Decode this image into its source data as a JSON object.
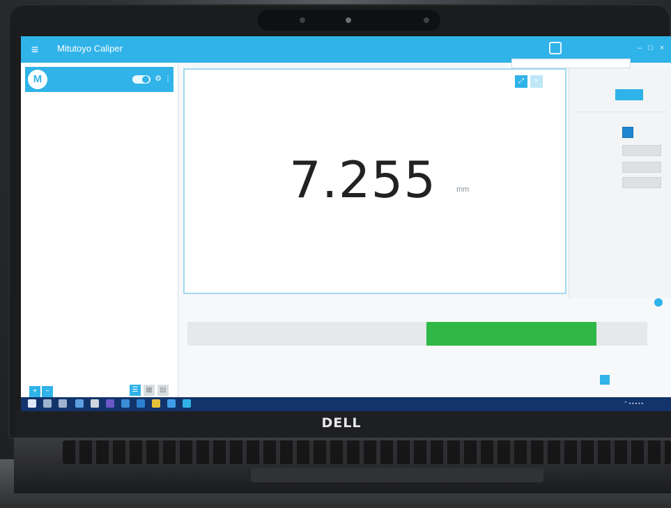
{
  "laptop": {
    "brand_logo": "DELL"
  },
  "app": {
    "title": "Mitutoyo Caliper",
    "menu_icon": "hamburger-icon",
    "tooltip": "",
    "colors": {
      "accent": "#30b3e8",
      "bar_fill": "#2fb845",
      "taskbar": "#12346a"
    }
  },
  "sidebar": {
    "device_name": "",
    "device_status": "",
    "device_initial": "M",
    "select_label": "",
    "select_value": ""
  },
  "reading": {
    "value": "7.255",
    "unit": "mm"
  },
  "right_panel": {
    "top_label": "",
    "top_button": "",
    "check_label": "",
    "field_label": "",
    "field_value": "",
    "bottom_label": ""
  },
  "bottom_panel": {
    "title": "",
    "bar_fill_start": 0.52,
    "bar_fill_end": 0.89,
    "labels": [
      "",
      "",
      "",
      ""
    ],
    "buttons": [
      "",
      "",
      ""
    ]
  },
  "taskbar": {
    "clock_time": "",
    "clock_date": ""
  }
}
